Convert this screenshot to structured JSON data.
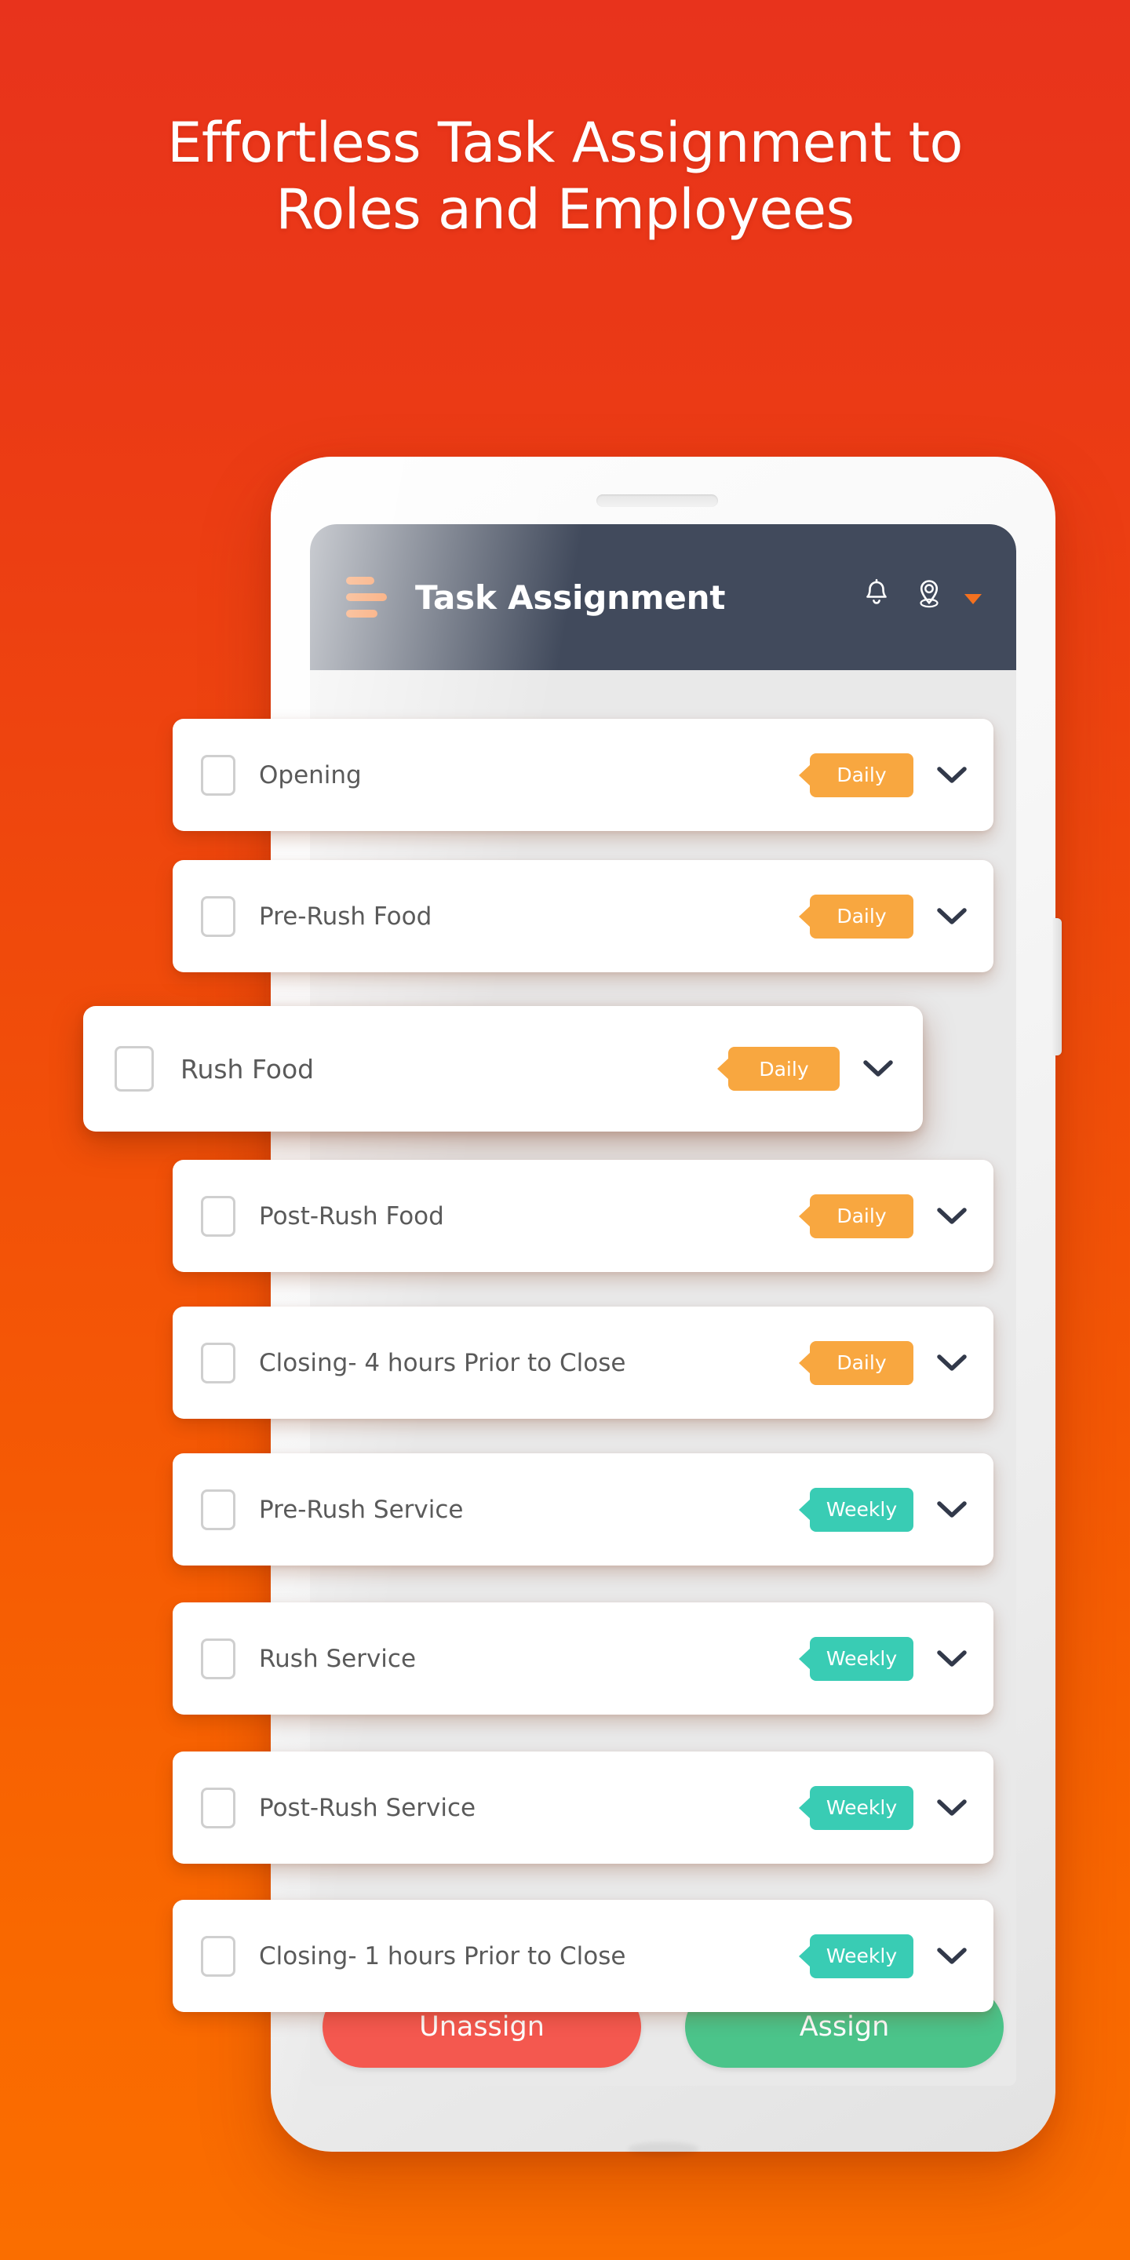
{
  "headline": {
    "line1": "Effortless Task Assignment to",
    "line2": "Roles and Employees"
  },
  "appbar": {
    "title": "Task Assignment",
    "menu_icon": "hamburger-icon",
    "notification_icon": "bell-icon",
    "location_icon": "location-pin-icon",
    "location_caret_icon": "caret-down-icon"
  },
  "colors": {
    "background_top": "#E8331C",
    "background_bottom": "#FA6E00",
    "appbar": "#414A5C",
    "accent_orange": "#F4711F",
    "badge_daily": "#F8A740",
    "badge_weekly": "#39CCB4",
    "button_unassign": "#F4584F",
    "button_assign": "#4BC48A",
    "screen_background": "#E9E9E9",
    "card": "#FFFFFF",
    "label_text": "#5A5A5A"
  },
  "tasks": [
    {
      "label": "Opening",
      "badge": "Daily",
      "badge_type": "daily",
      "checked": false,
      "featured": false
    },
    {
      "label": "Pre-Rush Food",
      "badge": "Daily",
      "badge_type": "daily",
      "checked": false,
      "featured": false
    },
    {
      "label": "Rush Food",
      "badge": "Daily",
      "badge_type": "daily",
      "checked": false,
      "featured": true
    },
    {
      "label": "Post-Rush Food",
      "badge": "Daily",
      "badge_type": "daily",
      "checked": false,
      "featured": false
    },
    {
      "label": "Closing- 4 hours Prior to Close",
      "badge": "Daily",
      "badge_type": "daily",
      "checked": false,
      "featured": false
    },
    {
      "label": "Pre-Rush Service",
      "badge": "Weekly",
      "badge_type": "weekly",
      "checked": false,
      "featured": false
    },
    {
      "label": "Rush Service",
      "badge": "Weekly",
      "badge_type": "weekly",
      "checked": false,
      "featured": false
    },
    {
      "label": "Post-Rush Service",
      "badge": "Weekly",
      "badge_type": "weekly",
      "checked": false,
      "featured": false
    },
    {
      "label": "Closing- 1 hours Prior to Close",
      "badge": "Weekly",
      "badge_type": "weekly",
      "checked": false,
      "featured": false
    }
  ],
  "actions": {
    "unassign_label": "Unassign",
    "assign_label": "Assign"
  }
}
